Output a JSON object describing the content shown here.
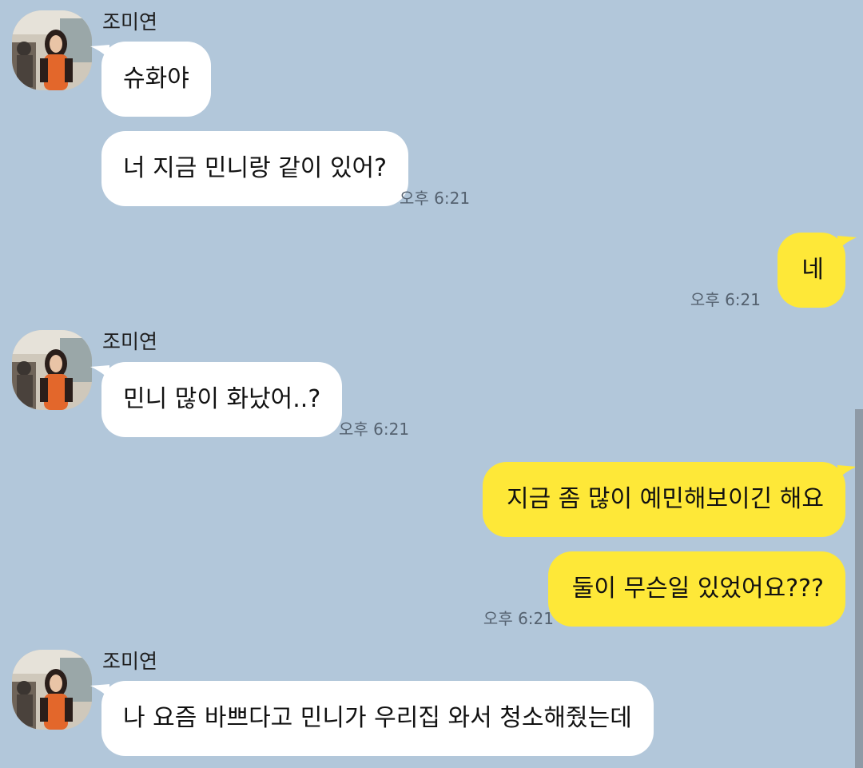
{
  "colors": {
    "background": "#b2c7da",
    "incoming_bubble": "#ffffff",
    "outgoing_bubble": "#fee838",
    "timestamp": "#556270"
  },
  "groups": [
    {
      "sender": "조미연",
      "messages": [
        "슈화야",
        "너 지금 민니랑 같이 있어?"
      ],
      "time": "오후 6:21"
    },
    {
      "outgoing": true,
      "messages": [
        "네"
      ],
      "time": "오후 6:21"
    },
    {
      "sender": "조미연",
      "messages": [
        "민니 많이 화났어..?"
      ],
      "time": "오후 6:21"
    },
    {
      "outgoing": true,
      "messages": [
        "지금 좀 많이 예민해보이긴 해요",
        "둘이 무슨일 있었어요???"
      ],
      "time": "오후 6:21"
    },
    {
      "sender": "조미연",
      "messages": [
        "나 요즘 바쁘다고 민니가 우리집 와서 청소해줬는데"
      ]
    }
  ]
}
